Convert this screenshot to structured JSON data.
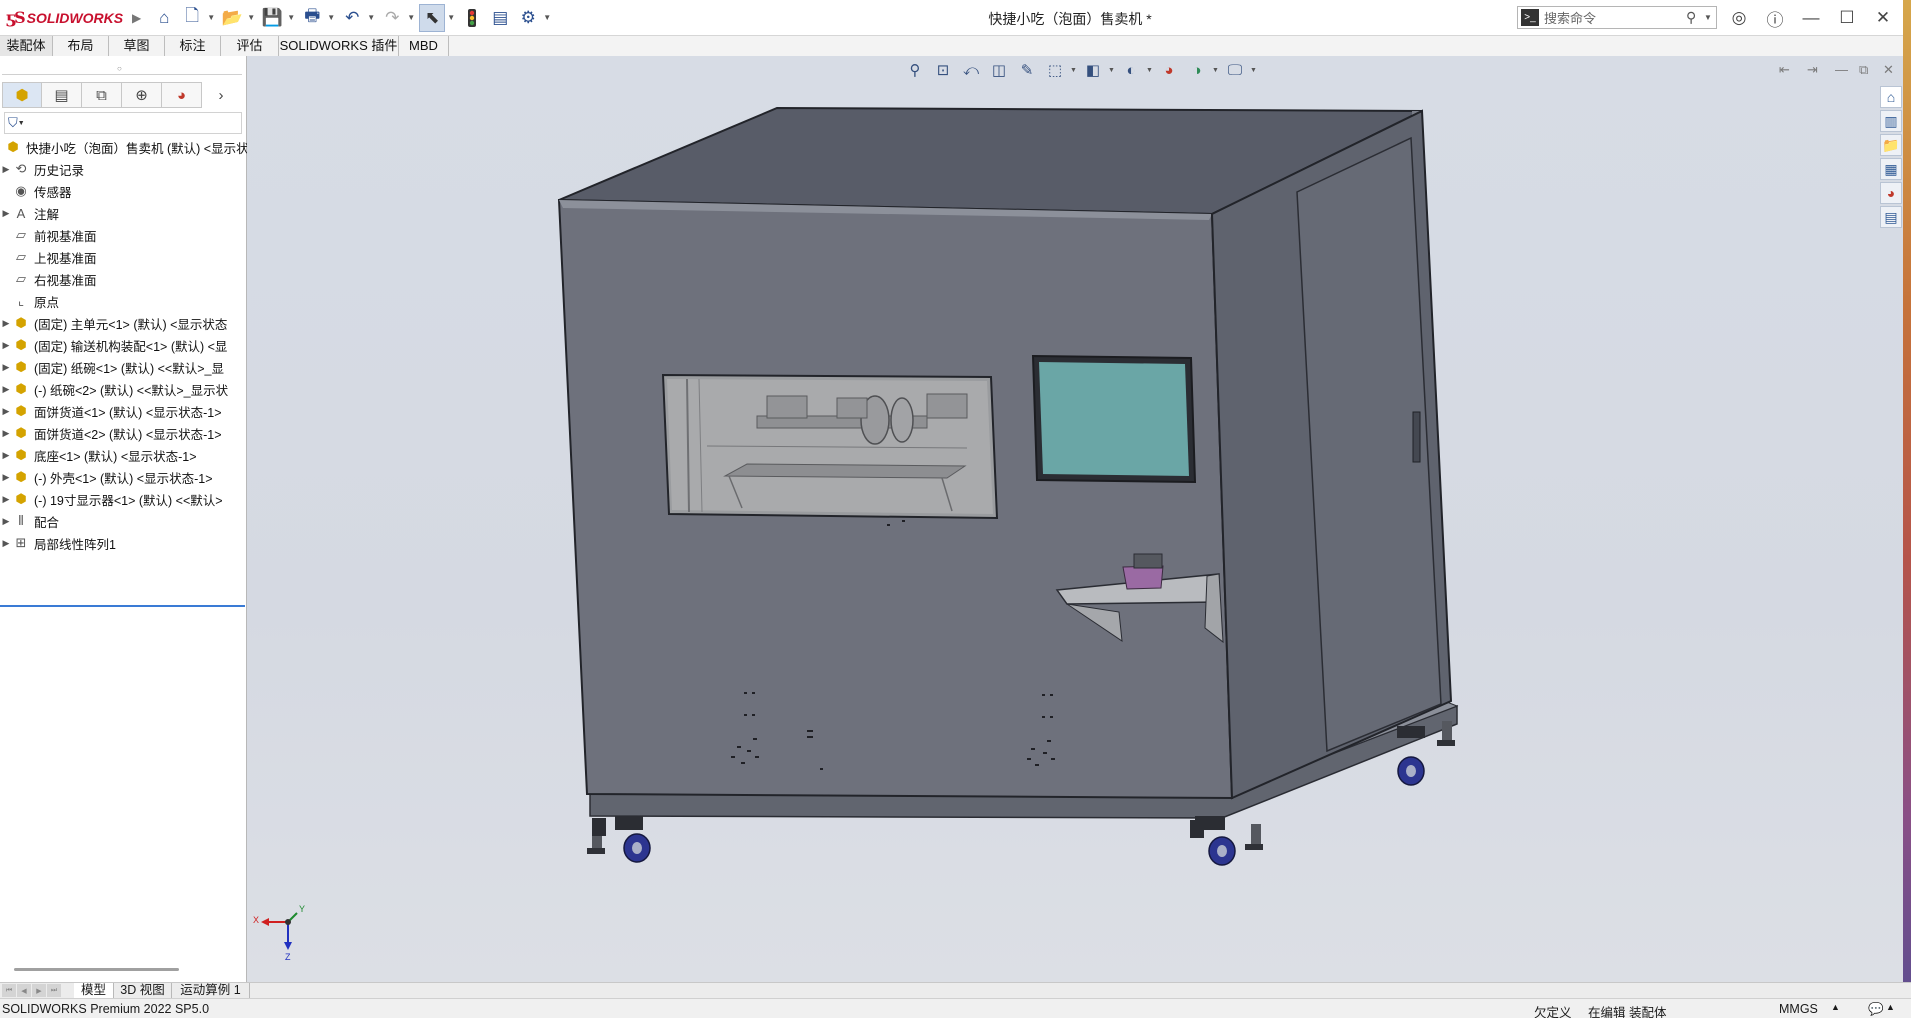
{
  "app": {
    "logo_text": "SOLIDWORKS",
    "window_title": "快捷小吃（泡面）售卖机 *"
  },
  "quick_access": {
    "icons": [
      "home-icon",
      "new-file-icon",
      "open-file-icon",
      "save-icon",
      "print-icon",
      "undo-icon",
      "redo-icon",
      "select-icon",
      "rebuild-icon",
      "file-properties-icon",
      "options-icon"
    ]
  },
  "search": {
    "placeholder": "搜索命令"
  },
  "ribbon": {
    "tabs": [
      "装配体",
      "布局",
      "草图",
      "标注",
      "评估",
      "SOLIDWORKS 插件",
      "MBD"
    ]
  },
  "feature_tree": {
    "root_label": "快捷小吃（泡面）售卖机 (默认) <显示状",
    "items": [
      {
        "label": "历史记录",
        "expandable": true,
        "icon": "history-icon"
      },
      {
        "label": "传感器",
        "expandable": false,
        "icon": "sensor-icon"
      },
      {
        "label": "注解",
        "expandable": true,
        "icon": "annotation-icon"
      },
      {
        "label": "前视基准面",
        "expandable": false,
        "icon": "plane-icon"
      },
      {
        "label": "上视基准面",
        "expandable": false,
        "icon": "plane-icon"
      },
      {
        "label": "右视基准面",
        "expandable": false,
        "icon": "plane-icon"
      },
      {
        "label": "原点",
        "expandable": false,
        "icon": "origin-icon"
      },
      {
        "label": "(固定) 主单元<1> (默认) <显示状态",
        "expandable": true,
        "icon": "assembly-icon"
      },
      {
        "label": "(固定) 输送机构装配<1> (默认) <显",
        "expandable": true,
        "icon": "assembly-icon"
      },
      {
        "label": "(固定) 纸碗<1> (默认) <<默认>_显",
        "expandable": true,
        "icon": "assembly-icon"
      },
      {
        "label": "(-) 纸碗<2> (默认) <<默认>_显示状",
        "expandable": true,
        "icon": "assembly-icon"
      },
      {
        "label": "面饼货道<1> (默认) <显示状态-1>",
        "expandable": true,
        "icon": "assembly-icon"
      },
      {
        "label": "面饼货道<2> (默认) <显示状态-1>",
        "expandable": true,
        "icon": "assembly-icon"
      },
      {
        "label": "底座<1> (默认) <显示状态-1>",
        "expandable": true,
        "icon": "assembly-icon"
      },
      {
        "label": "(-) 外壳<1> (默认) <显示状态-1>",
        "expandable": true,
        "icon": "assembly-icon"
      },
      {
        "label": "(-) 19寸显示器<1> (默认) <<默认>",
        "expandable": true,
        "icon": "assembly-icon"
      },
      {
        "label": "配合",
        "expandable": true,
        "icon": "mates-icon"
      },
      {
        "label": "局部线性阵列1",
        "expandable": true,
        "icon": "pattern-icon"
      }
    ]
  },
  "bottom_tabs": [
    "模型",
    "3D 视图",
    "运动算例 1"
  ],
  "status": {
    "product": "SOLIDWORKS Premium 2022 SP5.0",
    "definition": "欠定义",
    "mode": "在编辑 装配体",
    "units": "MMGS"
  },
  "triad": {
    "x": "X",
    "y": "Y",
    "z": "Z"
  },
  "colors": {
    "brand_red": "#c8102e",
    "viewport_bg": "#d6dae3",
    "cabinet_front": "#6c6f7a",
    "cabinet_side": "#5f636e",
    "cabinet_top": "#585c68",
    "screen": "#6aa6a6",
    "caster_blue": "#2c3590",
    "cup_purple": "#9a6aa3"
  }
}
